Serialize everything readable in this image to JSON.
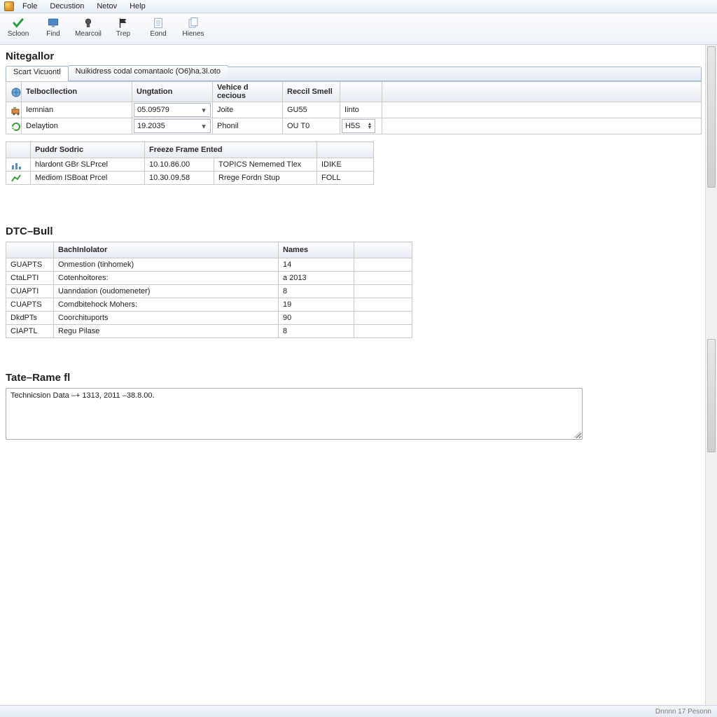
{
  "menu": {
    "items": [
      "Fole",
      "Decustion",
      "Netov",
      "Help"
    ]
  },
  "toolbar": {
    "buttons": [
      {
        "name": "scloon-button",
        "label": "Scloon",
        "icon": "check-icon"
      },
      {
        "name": "find-button",
        "label": "Find",
        "icon": "monitor-icon"
      },
      {
        "name": "mearcol-button",
        "label": "Mearcoil",
        "icon": "chip-icon"
      },
      {
        "name": "trep-button",
        "label": "Trep",
        "icon": "flag-icon"
      },
      {
        "name": "eond-button",
        "label": "Eond",
        "icon": "doc-lines-icon"
      },
      {
        "name": "hienes-button",
        "label": "Hienes",
        "icon": "doc-stack-icon"
      }
    ]
  },
  "page_title": "Nitegallor",
  "tabs": {
    "active": "Scart Vicuontl",
    "second": "Nuikidress codal comantaolc (O6)ha.3l.oto"
  },
  "vehicle": {
    "headers": [
      "Telbocllection",
      "Ungtation",
      "Vehice d cecious",
      "Reccil Smell",
      ""
    ],
    "rows": [
      {
        "icon": "cart-icon",
        "label": "Iemnian",
        "combo": "05.09579",
        "col3": "Joite",
        "col4": "GU55",
        "col5_type": "text",
        "col5": "Iinto"
      },
      {
        "icon": "refresh-icon",
        "label": "Delaytion",
        "combo": "19.2035",
        "col3": "Phonil",
        "col4": "OU T0",
        "col5_type": "spin",
        "col5": "H5S"
      }
    ]
  },
  "freeze": {
    "headers": [
      "Puddr Sodric",
      "Freeze Frame Ented",
      "",
      ""
    ],
    "rows": [
      {
        "icon": "chart-bar-icon",
        "cells": [
          "hlardont GBr SLPrcel",
          "10.10.86.00",
          "TOPICS Nememed Tlex",
          "IDIKE"
        ]
      },
      {
        "icon": "chart-line-icon",
        "cells": [
          "Mediom ISBoat Prcel",
          "10.30.09.58",
          "Rrege Fordn Stup",
          "FOLL"
        ]
      }
    ]
  },
  "dtc": {
    "title": "DTC–Bull",
    "headers": [
      "",
      "BachInlolator",
      "Names",
      ""
    ],
    "rows": [
      {
        "code": "GUAPTS",
        "desc": "Onmestion (tinhomek)",
        "val": "14"
      },
      {
        "code": "CtaLPTI",
        "desc": "Cotenhoitores:",
        "val": "a 2013"
      },
      {
        "code": "CUAPTI",
        "desc": "Uanndation (oudomeneter)",
        "val": "8"
      },
      {
        "code": "CUAPTS",
        "desc": "Comdbitehock Mohers:",
        "val": "19"
      },
      {
        "code": "DkdPTs",
        "desc": "Coorchituports",
        "val": "90"
      },
      {
        "code": "CIAPTL",
        "desc": "Regu Pilase",
        "val": "8"
      }
    ]
  },
  "tate": {
    "title": "Tate–Rame fl",
    "text": "Technicsion Data –+ 1313, 2011 –38.8.00."
  },
  "status": "Dnnnn 17 Pesonn"
}
